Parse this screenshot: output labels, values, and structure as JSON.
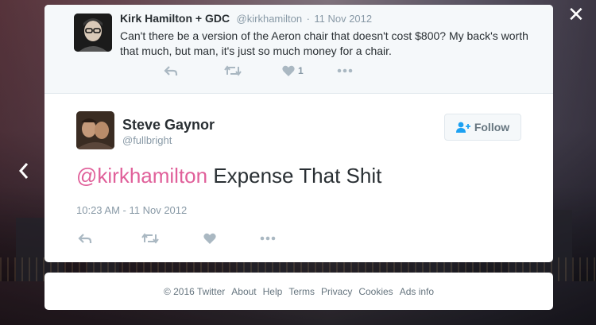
{
  "parent_tweet": {
    "name": "Kirk Hamilton + GDC",
    "handle": "@kirkhamilton",
    "separator": "·",
    "date": "11 Nov 2012",
    "text": "Can't there be a version of the Aeron chair that doesn't cost $800? My back's worth that much, but man, it's just so much money for a chair.",
    "like_count": "1"
  },
  "main_tweet": {
    "name": "Steve Gaynor",
    "handle": "@fullbright",
    "follow_label": "Follow",
    "mention": "@kirkhamilton",
    "text": " Expense That Shit",
    "timestamp": "10:23 AM - 11 Nov 2012"
  },
  "footer": {
    "copyright": "© 2016 Twitter",
    "links": [
      "About",
      "Help",
      "Terms",
      "Privacy",
      "Cookies",
      "Ads info"
    ]
  },
  "colors": {
    "mention": "#e0609a",
    "action_icon": "#aab8c2",
    "follow_icon": "#1da1f2"
  }
}
